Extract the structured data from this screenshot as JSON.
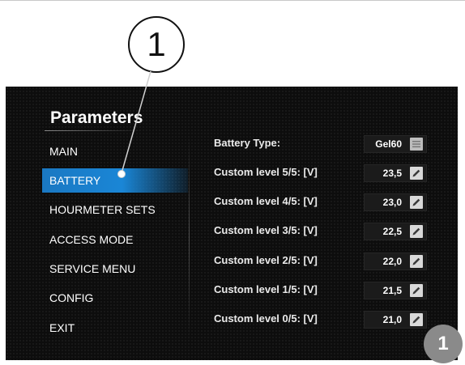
{
  "callout": {
    "number": "1"
  },
  "corner_badge": {
    "number": "1"
  },
  "panel": {
    "title": "Parameters"
  },
  "menu": [
    {
      "label": "MAIN",
      "active": false
    },
    {
      "label": "BATTERY",
      "active": true
    },
    {
      "label": "HOURMETER SETS",
      "active": false
    },
    {
      "label": "ACCESS MODE",
      "active": false
    },
    {
      "label": "SERVICE MENU",
      "active": false
    },
    {
      "label": "CONFIG",
      "active": false
    },
    {
      "label": "EXIT",
      "active": false
    }
  ],
  "settings": [
    {
      "label": "Battery Type:",
      "value": "Gel60",
      "control": "list-icon"
    },
    {
      "label": "Custom level 5/5: [V]",
      "value": "23,5",
      "control": "edit-pencil-icon"
    },
    {
      "label": "Custom level 4/5: [V]",
      "value": "23,0",
      "control": "edit-pencil-icon"
    },
    {
      "label": "Custom level 3/5: [V]",
      "value": "22,5",
      "control": "edit-pencil-icon"
    },
    {
      "label": "Custom level 2/5: [V]",
      "value": "22,0",
      "control": "edit-pencil-icon"
    },
    {
      "label": "Custom level 1/5: [V]",
      "value": "21,5",
      "control": "edit-pencil-icon"
    },
    {
      "label": "Custom level 0/5: [V]",
      "value": "21,0",
      "control": "edit-pencil-icon"
    }
  ],
  "colors": {
    "accent": "#1a86d6",
    "screen_bg": "#0d0d0d",
    "badge": "#8a8a8a"
  }
}
